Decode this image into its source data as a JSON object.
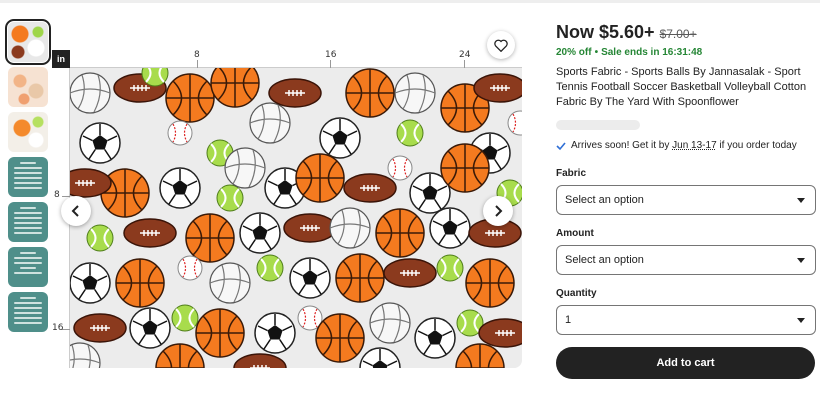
{
  "viewer": {
    "ruler_unit_label": "in",
    "top_ticks": [
      "8",
      "16",
      "24"
    ],
    "left_ticks": [
      "8",
      "16"
    ]
  },
  "icons": {
    "favorite": "heart-icon",
    "prev": "chevron-left-icon",
    "next": "chevron-right-icon",
    "check": "check-icon",
    "dropdown": "chevron-down-icon"
  },
  "product": {
    "price_now": "Now $5.60+",
    "price_original": "$7.00+",
    "discount": "20% off",
    "sale_ends": "Sale ends in 16:31:48",
    "title": "Sports Fabric - Sports Balls By Jannasalak - Sport Tennis Football Soccer Basketball Volleyball Cotton Fabric By The Yard With Spoonflower",
    "arrival_prefix": "Arrives soon! Get it by",
    "arrival_dates": "Jun 13-17",
    "arrival_suffix": "if you order today"
  },
  "options": {
    "fabric_label": "Fabric",
    "fabric_value": "Select an option",
    "amount_label": "Amount",
    "amount_value": "Select an option",
    "quantity_label": "Quantity",
    "quantity_value": "1"
  },
  "actions": {
    "add_to_cart": "Add to cart"
  },
  "colors": {
    "sale_green": "#258635",
    "button_dark": "#222222",
    "basketball": "#f47a1f",
    "tennis": "#9fd64a",
    "football": "#8b3a1e"
  }
}
